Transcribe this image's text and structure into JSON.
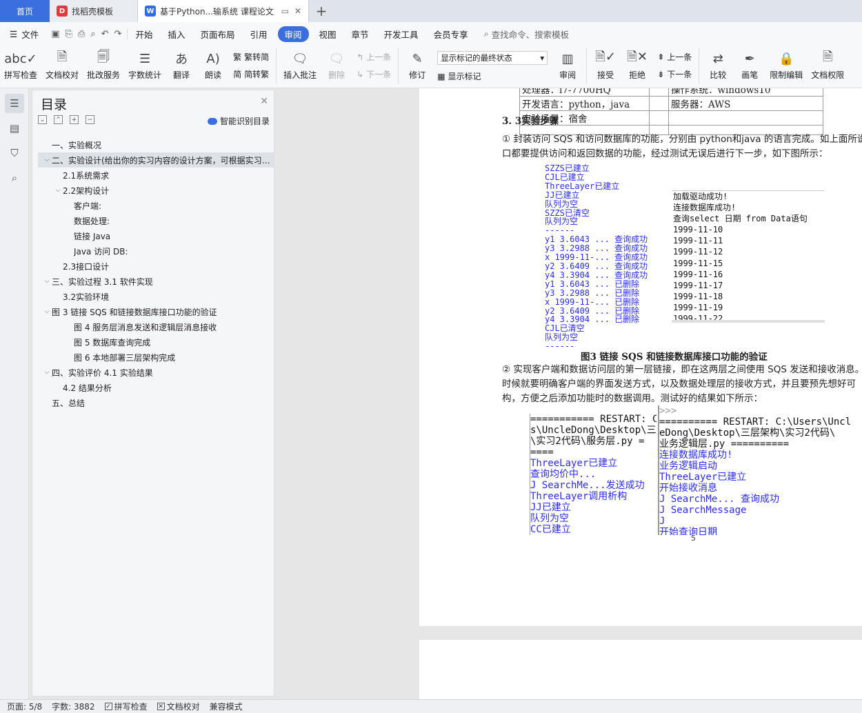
{
  "tabs": {
    "home": "首页",
    "docer": "找稻壳模板",
    "doc": "基于Python...输系统 课程论文"
  },
  "menu": {
    "file": "文件",
    "items": [
      "开始",
      "插入",
      "页面布局",
      "引用",
      "审阅",
      "视图",
      "章节",
      "开发工具",
      "会员专享"
    ],
    "active": "审阅",
    "search": "查找命令、搜索模板"
  },
  "ribbon": {
    "spell": "拼写检查",
    "proof": "文档校对",
    "batch": "批改服务",
    "wordcount": "字数统计",
    "translate": "翻译",
    "read": "朗读",
    "trad": "繁转简",
    "simp": "简转繁",
    "insert_comment": "插入批注",
    "delete": "删除",
    "prev": "上一条",
    "next": "下一条",
    "revise": "修订",
    "markup_state": "显示标记的最终状态",
    "show_markup": "显示标记",
    "review": "审阅",
    "accept": "接受",
    "reject": "拒绝",
    "prev2": "上一条",
    "next2": "下一条",
    "compare": "比较",
    "pen": "画笔",
    "restrict": "限制编辑",
    "perm": "文档权限"
  },
  "toc": {
    "title": "目录",
    "smart": "智能识别目录",
    "items": [
      {
        "text": "一、实验概况",
        "level": 1,
        "arrow": ""
      },
      {
        "text": "二、实验设计(给出你的实习内容的设计方案，可根据实习…",
        "level": 1,
        "arrow": "v",
        "selected": true
      },
      {
        "text": "2.1系统需求",
        "level": 2,
        "arrow": ""
      },
      {
        "text": "2.2架构设计",
        "level": 2,
        "arrow": "v"
      },
      {
        "text": "客户端:",
        "level": 3,
        "arrow": ""
      },
      {
        "text": "数据处理:",
        "level": 3,
        "arrow": ""
      },
      {
        "text": "链接 Java",
        "level": 3,
        "arrow": ""
      },
      {
        "text": "Java 访问 DB:",
        "level": 3,
        "arrow": ""
      },
      {
        "text": "2.3接口设计",
        "level": 2,
        "arrow": ""
      },
      {
        "text": "三、实验过程  3.1 软件实现",
        "level": 1,
        "arrow": "v"
      },
      {
        "text": "3.2实验环境",
        "level": 2,
        "arrow": ""
      },
      {
        "text": "图 3 链接 SQS 和链接数据库接口功能的验证",
        "level": 1,
        "arrow": "v"
      },
      {
        "text": "图 4 服务层消息发送和逻辑层消息接收",
        "level": 3,
        "arrow": ""
      },
      {
        "text": "图 5 数据库查询完成",
        "level": 3,
        "arrow": ""
      },
      {
        "text": "图 6 本地部署三层架构完成",
        "level": 3,
        "arrow": ""
      },
      {
        "text": "四、实验评价  4.1 实验结果",
        "level": 1,
        "arrow": "v"
      },
      {
        "text": "4.2 结果分析",
        "level": 2,
        "arrow": ""
      },
      {
        "text": "五、总结",
        "level": 1,
        "arrow": ""
      }
    ]
  },
  "doc": {
    "table": [
      [
        "处理器：i7-7700HQ",
        "",
        "操作系统：windows10"
      ],
      [
        "开发语言：python，java",
        "",
        "服务器：AWS"
      ],
      [
        "实验场景：宿舍",
        "",
        ""
      ],
      [
        "",
        "",
        ""
      ]
    ],
    "section": "3. 3实验步骤",
    "para1": [
      "① 封装访问 SQS 和访问数据库的功能，分别由 python和java 的语言完成。如上面所说，",
      "口都要提供访问和返回数据的功能，经过测试无误后进行下一步，如下图所示："
    ],
    "console_left": [
      "SZZS已建立",
      "CJL已建立",
      "ThreeLayer已建立",
      "JJ已建立",
      "队列为空",
      "SZZS已清空",
      "队列为空",
      "------",
      "y1 3.6043 ... 查询成功",
      "y3 3.2988 ... 查询成功",
      "x 1999-11-... 查询成功",
      "y2 3.6409 ... 查询成功",
      "y4 3.3904 ... 查询成功",
      "y1 3.6043 ... 已删除",
      "y3 3.2988 ... 已删除",
      "x 1999-11-... 已删除",
      "y2 3.6409 ... 已删除",
      "y4 3.3904 ... 已删除",
      "CJL已清空",
      "队列为空",
      "------"
    ],
    "console_right": [
      "加载驱动成功!",
      "连接数据库成功!",
      "查询select 日期 from Data语句",
      "1999-11-10",
      "1999-11-11",
      "1999-11-12",
      "1999-11-15",
      "1999-11-16",
      "1999-11-17",
      "1999-11-18",
      "1999-11-19",
      "1999-11-22"
    ],
    "caption": "图3 链接 SQS 和链接数据库接口功能的验证",
    "para2": [
      "② 实现客户端和数据访问层的第一层链接，即在这两层之间使用 SQS 发送和接收消息。",
      "时候就要明确客户端的界面发送方式，以及数据处理层的接收方式，并且要预先想好可",
      "构，方便之后添加功能时的数据调用。测试好的结果如下所示："
    ],
    "console2_left": [
      "=========== RESTART: C",
      "s\\UncleDong\\Desktop\\三",
      "\\实习2代码\\服务层.py =",
      "====",
      "ThreeLayer已建立",
      "查询均价中...",
      "J SearchMe...发送成功",
      "ThreeLayer调用析构",
      "JJ已建立",
      "队列为空",
      "CC已建立"
    ],
    "console2_right": [
      ">>>",
      "========== RESTART: C:\\Users\\Uncl",
      "eDong\\Desktop\\三层架构\\实习2代码\\",
      "业务逻辑层.py ==========",
      "连接数据库成功!",
      "业务逻辑启动",
      "ThreeLayer已建立",
      "开始接收消息",
      "J SearchMe... 查询成功",
      "J SearchMessage",
      "J",
      "开始查询日期"
    ],
    "page_number": "5"
  },
  "status": {
    "page": "页面: 5/8",
    "words": "字数: 3882",
    "spell": "拼写检查",
    "proof": "文档校对",
    "compat": "兼容模式"
  },
  "colors": {
    "accent": "#3b6fe0",
    "console_blue": "#2a2aff"
  }
}
